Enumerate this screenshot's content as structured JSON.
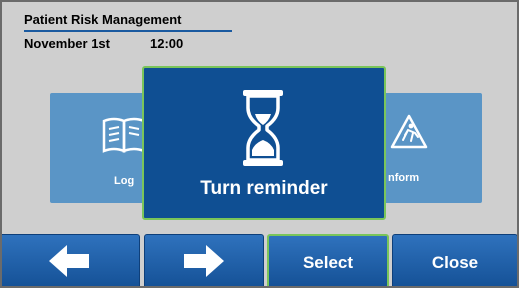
{
  "header": {
    "title": "Patient Risk Management",
    "date": "November 1st",
    "time": "12:00"
  },
  "background_tiles": [
    {
      "label": "Log",
      "icon": "book-icon"
    },
    {
      "label": "nform",
      "icon": "slip-warning-icon"
    }
  ],
  "modal": {
    "icon": "hourglass-icon",
    "text": "Turn reminder"
  },
  "toolbar": {
    "prev_icon": "arrow-left-icon",
    "next_icon": "arrow-right-icon",
    "select_label": "Select",
    "close_label": "Close"
  },
  "colors": {
    "background": "#cfcfcf",
    "modal": "#0f4f93",
    "accent_green": "#7ac55a",
    "tile": "#5a95c6",
    "button": "#1b5ca7"
  }
}
